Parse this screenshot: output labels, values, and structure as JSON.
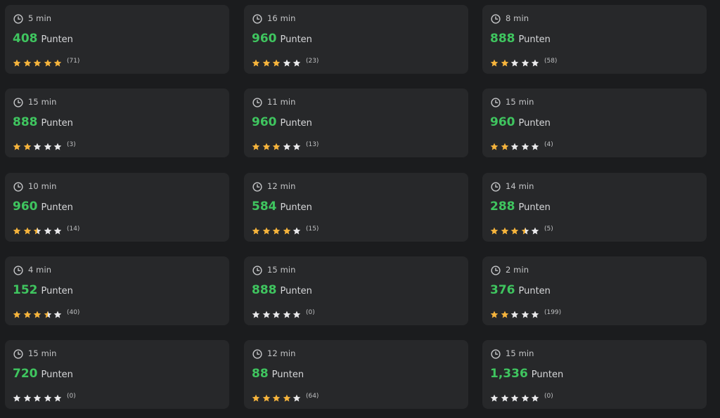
{
  "colors": {
    "background": "#1b1c1e",
    "card": "#27282a",
    "points": "#3fc55f",
    "star_filled": "#f6b43c",
    "star_empty": "#e9e9eb",
    "text_muted": "#c4c5c7"
  },
  "icons": {
    "time": "clock-icon",
    "rating": "star-icon"
  },
  "cards": [
    {
      "duration": "5 min",
      "points": "408",
      "points_unit": "Punten",
      "rating": 5,
      "rating_count": "(71)"
    },
    {
      "duration": "16 min",
      "points": "960",
      "points_unit": "Punten",
      "rating": 3,
      "rating_count": "(23)"
    },
    {
      "duration": "8 min",
      "points": "888",
      "points_unit": "Punten",
      "rating": 2,
      "rating_count": "(58)"
    },
    {
      "duration": "15 min",
      "points": "888",
      "points_unit": "Punten",
      "rating": 2,
      "rating_count": "(3)"
    },
    {
      "duration": "11 min",
      "points": "960",
      "points_unit": "Punten",
      "rating": 3,
      "rating_count": "(13)"
    },
    {
      "duration": "15 min",
      "points": "960",
      "points_unit": "Punten",
      "rating": 2,
      "rating_count": "(4)"
    },
    {
      "duration": "10 min",
      "points": "960",
      "points_unit": "Punten",
      "rating": 2.5,
      "rating_count": "(14)"
    },
    {
      "duration": "12 min",
      "points": "584",
      "points_unit": "Punten",
      "rating": 4,
      "rating_count": "(15)"
    },
    {
      "duration": "14 min",
      "points": "288",
      "points_unit": "Punten",
      "rating": 3.5,
      "rating_count": "(5)"
    },
    {
      "duration": "4 min",
      "points": "152",
      "points_unit": "Punten",
      "rating": 3.5,
      "rating_count": "(40)"
    },
    {
      "duration": "15 min",
      "points": "888",
      "points_unit": "Punten",
      "rating": 0,
      "rating_count": "(0)"
    },
    {
      "duration": "2 min",
      "points": "376",
      "points_unit": "Punten",
      "rating": 2,
      "rating_count": "(199)"
    },
    {
      "duration": "15 min",
      "points": "720",
      "points_unit": "Punten",
      "rating": 0,
      "rating_count": "(0)"
    },
    {
      "duration": "12 min",
      "points": "88",
      "points_unit": "Punten",
      "rating": 4,
      "rating_count": "(64)"
    },
    {
      "duration": "15 min",
      "points": "1,336",
      "points_unit": "Punten",
      "rating": 0,
      "rating_count": "(0)"
    }
  ]
}
